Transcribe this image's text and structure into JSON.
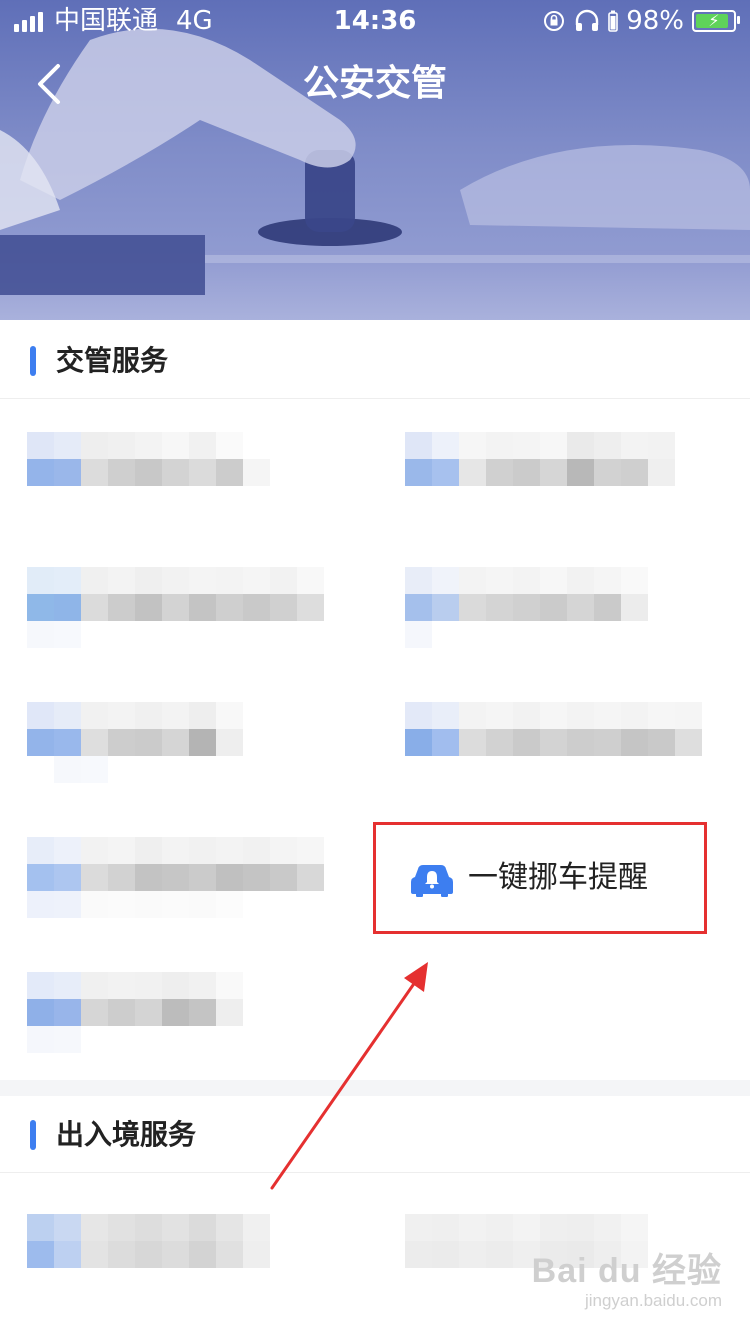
{
  "status_bar": {
    "carrier": "中国联通",
    "network": "4G",
    "time": "14:36",
    "battery": "98%"
  },
  "header": {
    "title": "公安交管",
    "back_icon": "chevron-left-icon"
  },
  "sections": [
    {
      "title": "交管服务"
    },
    {
      "title": "出入境服务"
    }
  ],
  "highlighted_item": {
    "label": "一键挪车提醒",
    "icon": "car-alert-icon"
  },
  "watermark": {
    "main": "Bai du 经验",
    "sub": "jingyan.baidu.com"
  },
  "colors": {
    "accent": "#3d7ef0",
    "highlight_border": "#e53030",
    "annotation_arrow": "#e53030"
  }
}
